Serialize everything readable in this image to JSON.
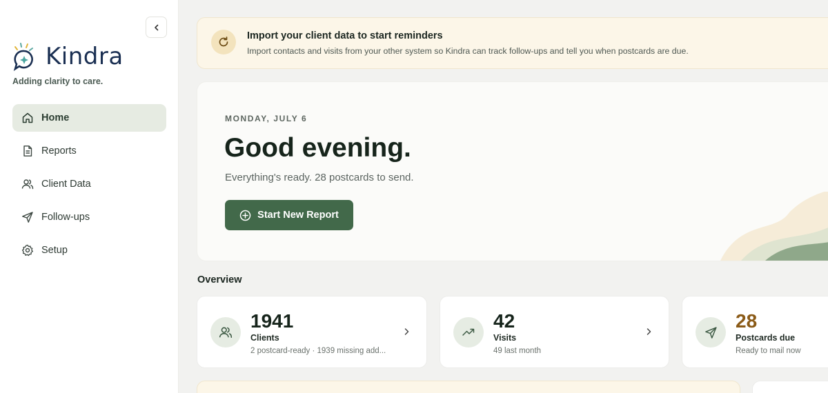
{
  "brand": {
    "name": "Kindra",
    "tagline": "Adding clarity to care."
  },
  "sidebar": {
    "collapse_icon": "chevron-left-icon",
    "items": [
      {
        "label": "Home",
        "icon": "home-icon",
        "active": true
      },
      {
        "label": "Reports",
        "icon": "file-icon",
        "active": false
      },
      {
        "label": "Client Data",
        "icon": "users-icon",
        "active": false
      },
      {
        "label": "Follow-ups",
        "icon": "send-icon",
        "active": false
      },
      {
        "label": "Setup",
        "icon": "gear-icon",
        "active": false
      }
    ]
  },
  "banner": {
    "icon": "refresh-icon",
    "title": "Import your client data to start reminders",
    "text": "Import contacts and visits from your other system so Kindra can track follow-ups and tell you when postcards are due."
  },
  "hero": {
    "date": "MONDAY, JULY 6",
    "greeting": "Good evening.",
    "subtitle": "Everything's ready. 28 postcards to send.",
    "button_label": "Start New Report",
    "button_icon": "plus-circle-icon"
  },
  "overview": {
    "title": "Overview",
    "cards": [
      {
        "value": "1941",
        "label": "Clients",
        "sub": "2 postcard-ready · 1939 missing add...",
        "icon": "users-icon"
      },
      {
        "value": "42",
        "label": "Visits",
        "sub": "49 last month",
        "icon": "trending-up-icon"
      },
      {
        "value": "28",
        "label": "Postcards due",
        "sub": "Ready to mail now",
        "icon": "send-icon"
      }
    ]
  },
  "colors": {
    "primary": "#42694a",
    "accent_amber": "#8a5a17",
    "banner_bg": "#fcf6e8",
    "active_nav_bg": "#e6ebe2"
  }
}
